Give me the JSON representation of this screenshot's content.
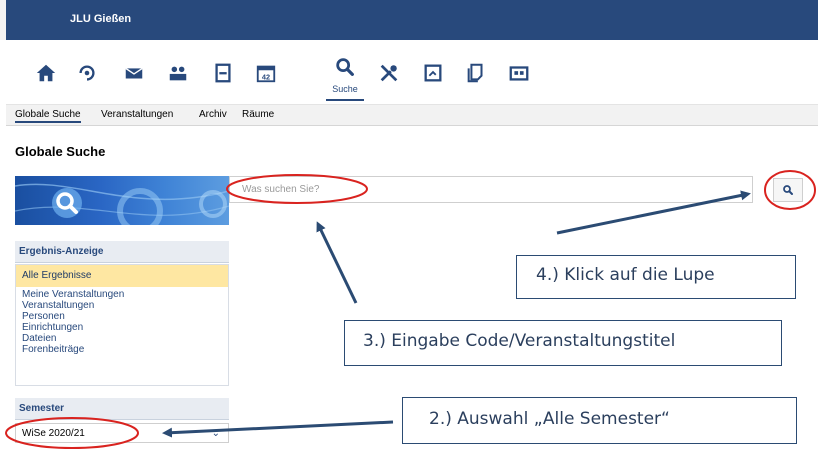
{
  "header": {
    "site_name": "JLU Gießen"
  },
  "nav": {
    "icons": [
      "home-icon",
      "activity-icon",
      "mail-icon",
      "people-icon",
      "profile-icon",
      "calendar-icon",
      "search-icon",
      "tools-icon",
      "admin-icon",
      "documents-icon",
      "rooms-icon"
    ],
    "calendar_number": "42",
    "active_label": "Suche"
  },
  "tabs": [
    "Globale Suche",
    "Veranstaltungen",
    "Archiv",
    "Räume"
  ],
  "page_title": "Globale Suche",
  "search": {
    "placeholder": "Was suchen Sie?"
  },
  "results_panel": {
    "title": "Ergebnis-Anzeige",
    "items": [
      "Alle Ergebnisse",
      "Meine Veranstaltungen",
      "Veranstaltungen",
      "Personen",
      "Einrichtungen",
      "Dateien",
      "Forenbeiträge"
    ]
  },
  "semester_panel": {
    "title": "Semester",
    "selected": "WiSe 2020/21"
  },
  "callouts": {
    "step4": "4.) Klick auf die Lupe",
    "step3": "3.) Eingabe Code/Veranstaltungstitel",
    "step2": "2.) Auswahl „Alle Semester“"
  },
  "colors": {
    "brand": "#28497c",
    "highlight": "#fee7a2",
    "annotation": "#d9231f",
    "arrow": "#2b4b73"
  }
}
